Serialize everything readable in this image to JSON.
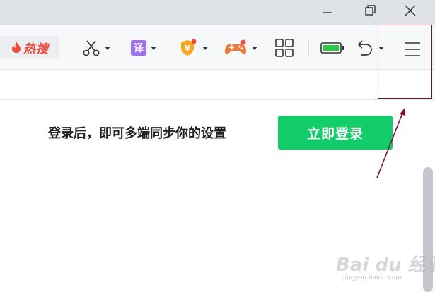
{
  "window_controls": {
    "minimize_icon": "minimize-icon",
    "restore_icon": "restore-icon",
    "close_icon": "close-icon"
  },
  "toolbar": {
    "hot_search_label": "热搜",
    "hot_search_color": "#f04a3c",
    "translate_badge": "译",
    "coupon_symbol": "¥",
    "icons": [
      "scissors-icon",
      "translate-icon",
      "coupon-icon",
      "game-icon",
      "apps-grid-icon",
      "battery-icon",
      "undo-icon",
      "menu-icon"
    ]
  },
  "login_panel": {
    "hint": "登录后，即可多端同步你的设置",
    "button_label": "立即登录",
    "button_color": "#13cc6a"
  },
  "annotation": {
    "box_color": "#7a1030"
  },
  "watermark": {
    "text": "Bai du 经验",
    "sub": "jingyan.baidu.com"
  }
}
